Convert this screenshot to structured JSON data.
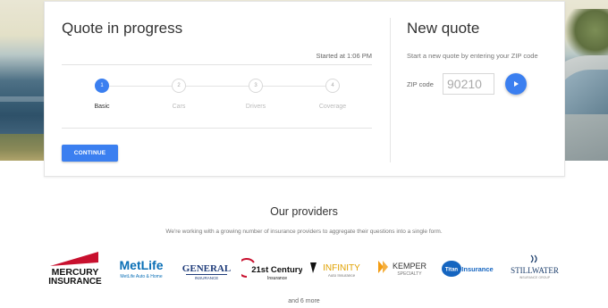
{
  "quote": {
    "title": "Quote in progress",
    "started": "Started at 1:06 PM",
    "steps": [
      {
        "number": "1",
        "label": "Basic",
        "active": true
      },
      {
        "number": "2",
        "label": "Cars",
        "active": false
      },
      {
        "number": "3",
        "label": "Drivers",
        "active": false
      },
      {
        "number": "4",
        "label": "Coverage",
        "active": false
      }
    ],
    "continue_label": "CONTINUE"
  },
  "new_quote": {
    "title": "New quote",
    "description": "Start a new quote by entering your ZIP code",
    "zip_label": "ZIP code",
    "zip_value": "90210"
  },
  "providers": {
    "title": "Our providers",
    "description": "We're working with a growing number of insurance providers to aggregate their questions into a single form.",
    "logos": [
      {
        "name": "Mercury Insurance",
        "line1": "MERCURY",
        "line2": "INSURANCE"
      },
      {
        "name": "MetLife",
        "line1": "MetLife",
        "line2": "MetLife Auto & Home"
      },
      {
        "name": "General",
        "line1": "GENERAL",
        "line2": "INSURANCE"
      },
      {
        "name": "21st Century",
        "line1": "21st Century",
        "line2": "Insurance"
      },
      {
        "name": "Infinity",
        "line1": "INFINITY",
        "line2": "Auto Insurance"
      },
      {
        "name": "Kemper",
        "line1": "KEMPER",
        "line2": "SPECIALTY"
      },
      {
        "name": "Titan",
        "line1": "Titan",
        "line2": "Insurance"
      },
      {
        "name": "Stillwater",
        "line1": "STILLWATER",
        "line2": "INSURANCE GROUP"
      }
    ],
    "more": "and 6 more"
  },
  "colors": {
    "accent": "#3b7ff0",
    "mercury_red": "#c8102e",
    "metlife_blue": "#0a6fb6",
    "general_navy": "#1f3c7a",
    "kemper_orange": "#f39c12",
    "titan_blue": "#1565c0",
    "stillwater_navy": "#1b3d6b"
  }
}
